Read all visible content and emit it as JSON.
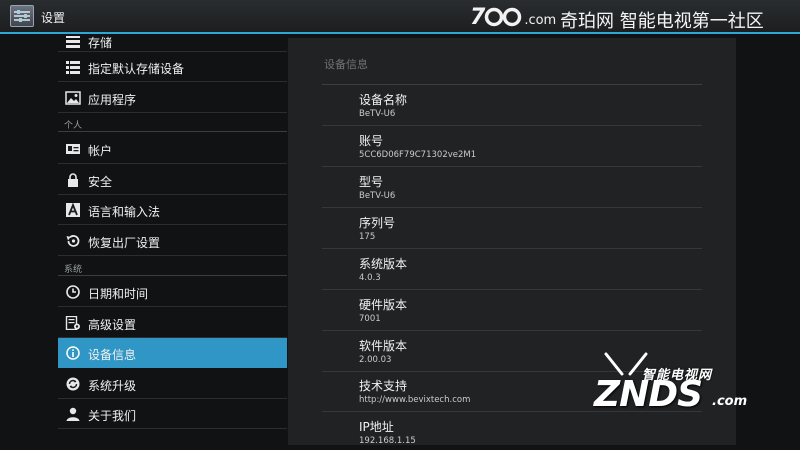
{
  "topbar": {
    "title": "设置",
    "watermark_logo": "7",
    "watermark_logo_suffix": ".com",
    "watermark_text": "奇珀网 智能电视第一社区"
  },
  "sidebar": {
    "items": [
      {
        "label": "存储",
        "icon": "storage-icon"
      },
      {
        "label": "指定默认存储设备",
        "icon": "storage-default-icon"
      },
      {
        "label": "应用程序",
        "icon": "apps-icon"
      },
      {
        "label": "帐户",
        "icon": "account-icon"
      },
      {
        "label": "安全",
        "icon": "lock-icon"
      },
      {
        "label": "语言和输入法",
        "icon": "language-icon"
      },
      {
        "label": "恢复出厂设置",
        "icon": "restore-icon"
      },
      {
        "label": "日期和时间",
        "icon": "clock-icon"
      },
      {
        "label": "高级设置",
        "icon": "advanced-settings-icon"
      },
      {
        "label": "设备信息",
        "icon": "info-icon",
        "selected": true
      },
      {
        "label": "系统升级",
        "icon": "upgrade-icon"
      },
      {
        "label": "关于我们",
        "icon": "person-icon"
      }
    ],
    "sections": {
      "personal": "个人",
      "system": "系统"
    }
  },
  "panel": {
    "heading": "设备信息",
    "rows": [
      {
        "title": "设备名称",
        "value": "BeTV-U6"
      },
      {
        "title": "账号",
        "value": "5CC6D06F79C71302ve2M1"
      },
      {
        "title": "型号",
        "value": "BeTV-U6"
      },
      {
        "title": "序列号",
        "value": "175"
      },
      {
        "title": "系统版本",
        "value": "4.0.3"
      },
      {
        "title": "硬件版本",
        "value": "7001"
      },
      {
        "title": "软件版本",
        "value": "2.00.03"
      },
      {
        "title": "技术支持",
        "value": "http://www.bevixtech.com"
      },
      {
        "title": "IP地址",
        "value": "192.168.1.15"
      }
    ]
  },
  "watermark_znds": {
    "cn": "智能电视网",
    "big": "ZNDS",
    "com": ".com"
  },
  "colors": {
    "accent": "#2ea7d6",
    "selected": "#2f96c5",
    "panel_bg": "#202224",
    "page_bg": "#101213"
  }
}
